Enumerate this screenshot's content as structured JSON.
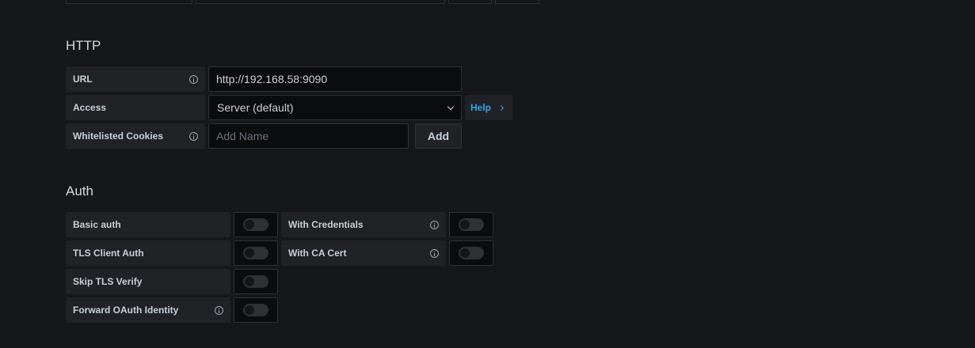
{
  "http": {
    "title": "HTTP",
    "url": {
      "label": "URL",
      "value": "http://192.168.58:9090"
    },
    "access": {
      "label": "Access",
      "value": "Server (default)"
    },
    "help": {
      "label": "Help"
    },
    "cookies": {
      "label": "Whitelisted Cookies",
      "placeholder": "Add Name",
      "add_label": "Add"
    }
  },
  "auth": {
    "title": "Auth",
    "basic_auth": {
      "label": "Basic auth",
      "enabled": false
    },
    "with_credentials": {
      "label": "With Credentials",
      "enabled": false
    },
    "tls_client_auth": {
      "label": "TLS Client Auth",
      "enabled": false
    },
    "with_ca_cert": {
      "label": "With CA Cert",
      "enabled": false
    },
    "skip_tls_verify": {
      "label": "Skip TLS Verify",
      "enabled": false
    },
    "forward_oauth": {
      "label": "Forward OAuth Identity",
      "enabled": false
    }
  },
  "colors": {
    "background": "#161719",
    "label_bg": "#202226",
    "input_bg": "#0b0c0e",
    "border": "#2c3235",
    "link": "#33a2e5"
  }
}
